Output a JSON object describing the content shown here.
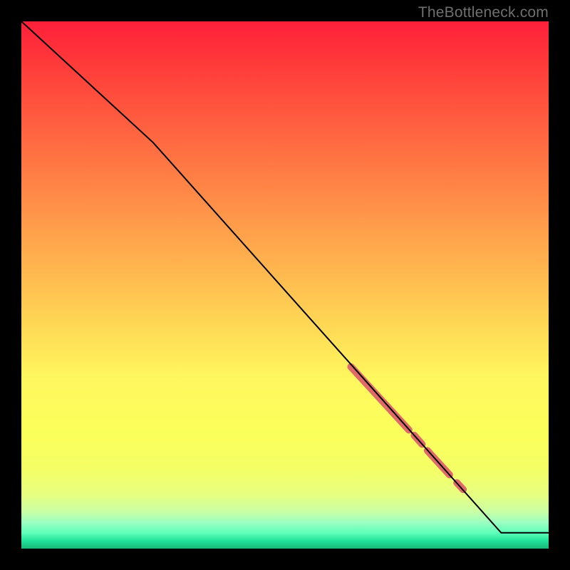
{
  "attribution": "TheBottleneck.com",
  "chart_data": {
    "type": "line",
    "title": "",
    "xlabel": "",
    "ylabel": "",
    "xlim": [
      0,
      1
    ],
    "ylim": [
      0,
      1
    ],
    "line": {
      "points": [
        {
          "x": 0.0,
          "y": 1.0
        },
        {
          "x": 0.25,
          "y": 0.77
        },
        {
          "x": 0.91,
          "y": 0.03
        },
        {
          "x": 1.0,
          "y": 0.03
        }
      ],
      "color": "#000000",
      "width": 2
    },
    "highlights": [
      {
        "x0": 0.625,
        "x1": 0.735,
        "y0": 0.345,
        "y1": 0.225,
        "width": 10,
        "color": "#e06a6a"
      },
      {
        "x0": 0.745,
        "x1": 0.76,
        "y0": 0.215,
        "y1": 0.198,
        "width": 10,
        "color": "#e06a6a"
      },
      {
        "x0": 0.77,
        "x1": 0.812,
        "y0": 0.186,
        "y1": 0.14,
        "width": 10,
        "color": "#e06a6a"
      },
      {
        "x0": 0.826,
        "x1": 0.838,
        "y0": 0.125,
        "y1": 0.112,
        "width": 10,
        "color": "#e06a6a"
      }
    ],
    "background_gradient": {
      "type": "vertical",
      "stops": [
        {
          "pos": 0.0,
          "color": "#ff1f3a"
        },
        {
          "pos": 0.5,
          "color": "#ffcf55"
        },
        {
          "pos": 0.8,
          "color": "#f6ff60"
        },
        {
          "pos": 1.0,
          "color": "#17b877"
        }
      ]
    }
  }
}
